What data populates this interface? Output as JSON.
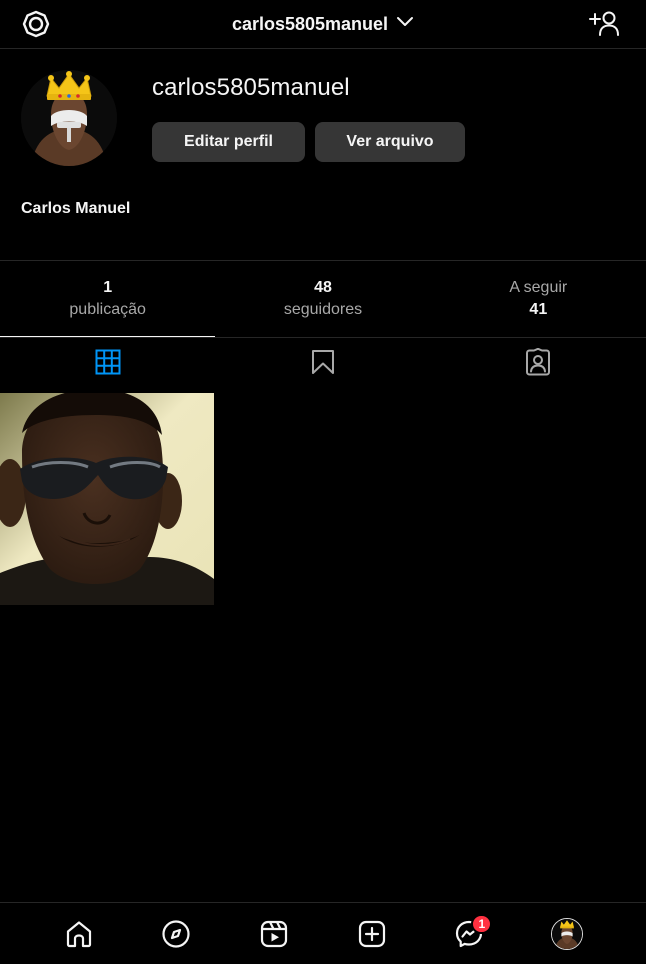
{
  "header": {
    "username": "carlos5805manuel",
    "settings_icon": "gear-icon",
    "dropdown_icon": "chevron-down-icon",
    "add_user_icon": "add-user-icon"
  },
  "profile": {
    "username": "carlos5805manuel",
    "full_name": "Carlos Manuel",
    "edit_button": "Editar perfil",
    "archive_button": "Ver arquivo"
  },
  "stats": [
    {
      "value": "1",
      "label": "publicação"
    },
    {
      "value": "48",
      "label": "seguidores"
    },
    {
      "value": "41",
      "label": "A seguir"
    }
  ],
  "tabs": [
    {
      "name": "posts",
      "icon": "grid-icon",
      "active": true
    },
    {
      "name": "saved",
      "icon": "bookmark-icon",
      "active": false
    },
    {
      "name": "tagged",
      "icon": "tagged-user-icon",
      "active": false
    }
  ],
  "bottom_nav": {
    "items": [
      "home-icon",
      "explore-icon",
      "reels-icon",
      "new-post-icon",
      "messenger-icon",
      "profile-avatar"
    ],
    "messenger_badge": "1"
  },
  "colors": {
    "background": "#000000",
    "button": "#363636",
    "accent": "#0095f6",
    "badge": "#ff3040",
    "crown": "#f5c518"
  }
}
